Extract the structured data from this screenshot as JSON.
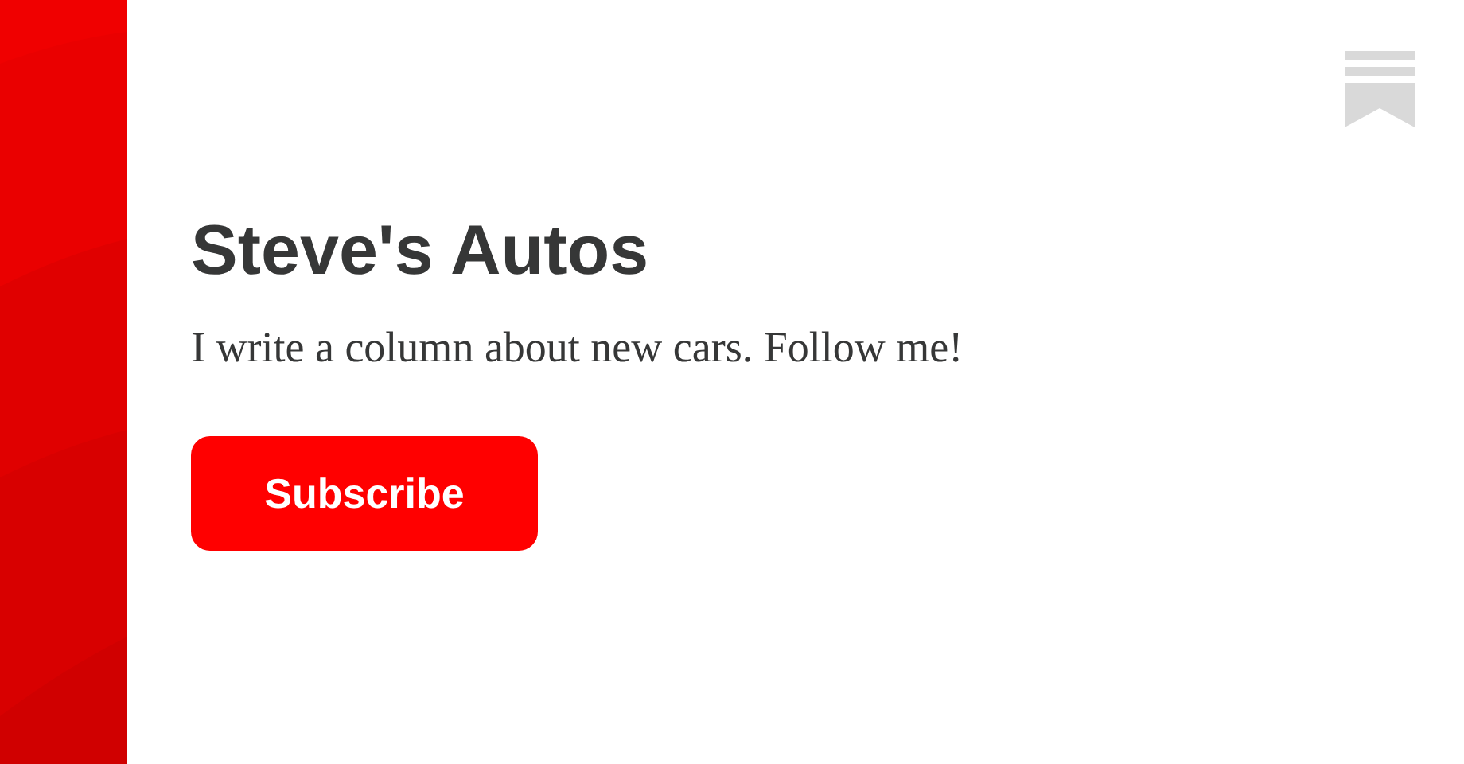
{
  "publication": {
    "title": "Steve's Autos",
    "description": "I write a column about new cars. Follow me!"
  },
  "subscribe_button": {
    "label": "Subscribe"
  }
}
